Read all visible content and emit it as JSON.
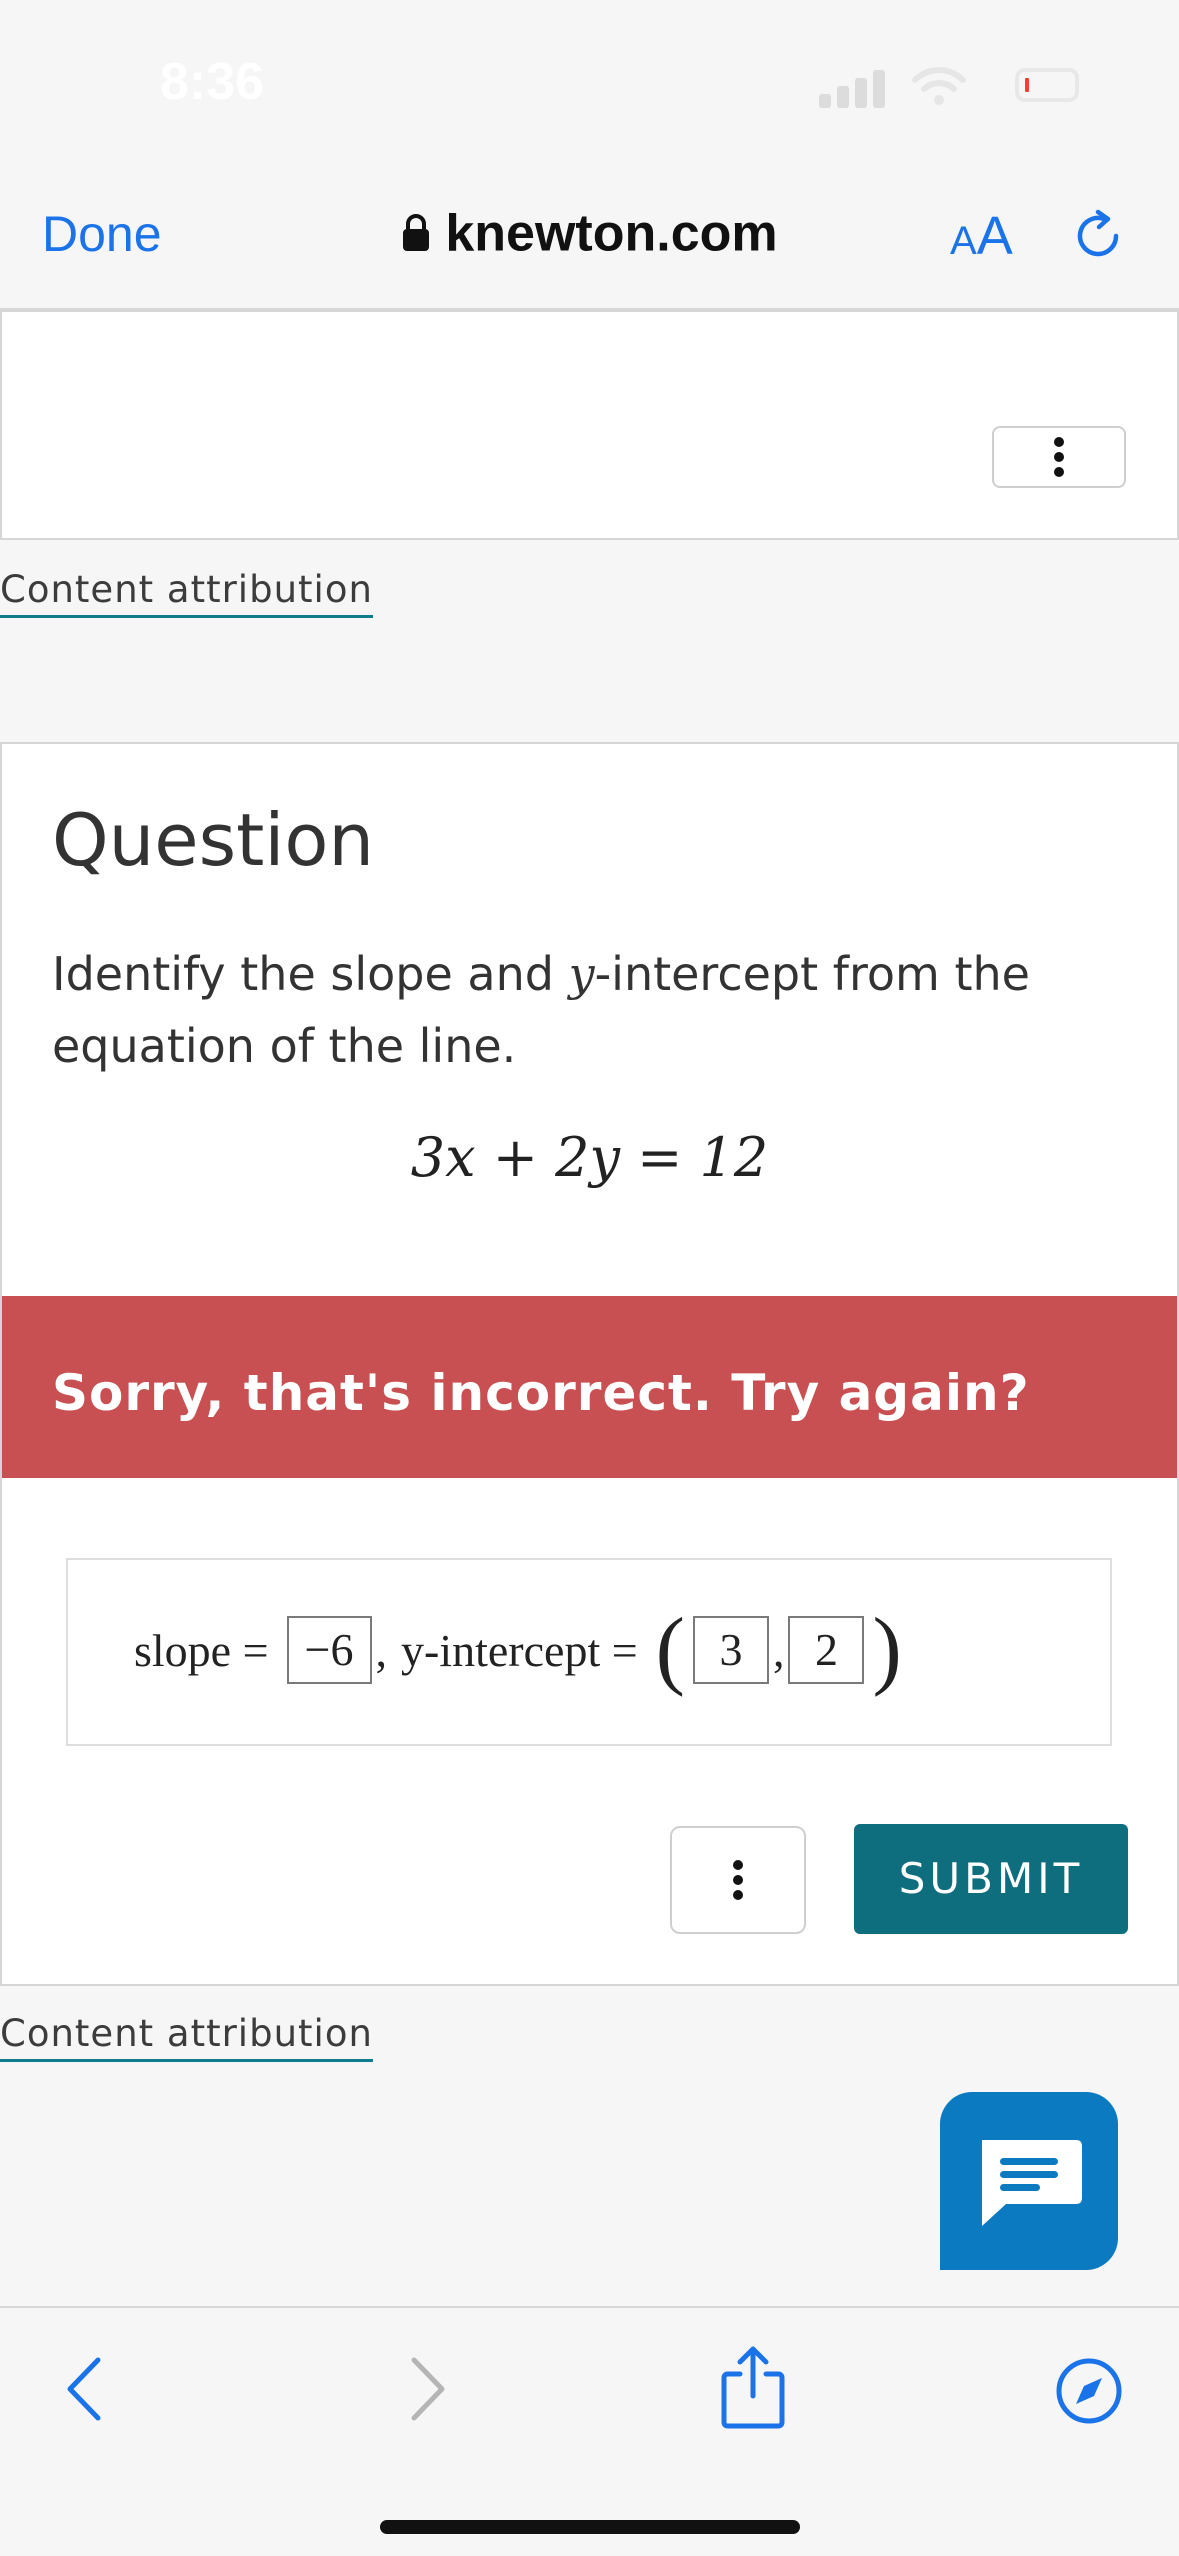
{
  "status_bar": {
    "time": "8:36"
  },
  "browser": {
    "done_label": "Done",
    "url": "knewton.com",
    "text_size_small": "A",
    "text_size_large": "A",
    "accent_color": "#1a73e8"
  },
  "top_panel": {
    "attribution": "Content attribution"
  },
  "question": {
    "title": "Question",
    "prompt_before": "Identify the slope and ",
    "prompt_var": "y",
    "prompt_after": "-intercept from the equation of the line.",
    "equation": "3x + 2y = 12"
  },
  "feedback": {
    "message": "Sorry, that's incorrect. Try again?",
    "color": "#c95052"
  },
  "answer": {
    "slope_label": "slope =",
    "slope_value": "−6",
    "separator": ",",
    "intercept_label": "y-intercept =",
    "intercept_x": "3",
    "intercept_comma": ",",
    "intercept_y": "2"
  },
  "actions": {
    "submit_label": "SUBMIT",
    "submit_color": "#0f6e7e"
  },
  "bottom_attribution": "Content attribution"
}
